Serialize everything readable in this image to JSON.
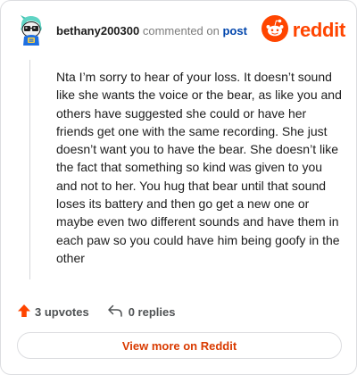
{
  "comment": {
    "username": "bethany200300",
    "commented_on": "commented on",
    "post_link": "post",
    "body": "Nta I’m sorry to hear of your loss. It doesn’t sound like she wants the voice or the bear, as like you and others have suggested she could or have her friends get one with the same recording. She just doesn’t want you to have the bear. She doesn’t like the fact that something so kind was given to you and not to her. You hug that bear until that sound loses its battery and then go get a new one or maybe even two different sounds and have them in each paw so you could have him being goofy in the other"
  },
  "brand": {
    "name": "reddit",
    "icon": "reddit-logo-icon",
    "color": "#ff4500"
  },
  "actions": {
    "upvotes_label": "3 upvotes",
    "replies_label": "0 replies",
    "upvote_icon": "upvote-arrow-icon",
    "reply_icon": "reply-arrow-icon",
    "upvote_color": "#ff4500"
  },
  "view_more": {
    "label": "View more on Reddit",
    "color": "#d93a00"
  },
  "avatar": {
    "icon": "snoo-avatar-icon"
  }
}
